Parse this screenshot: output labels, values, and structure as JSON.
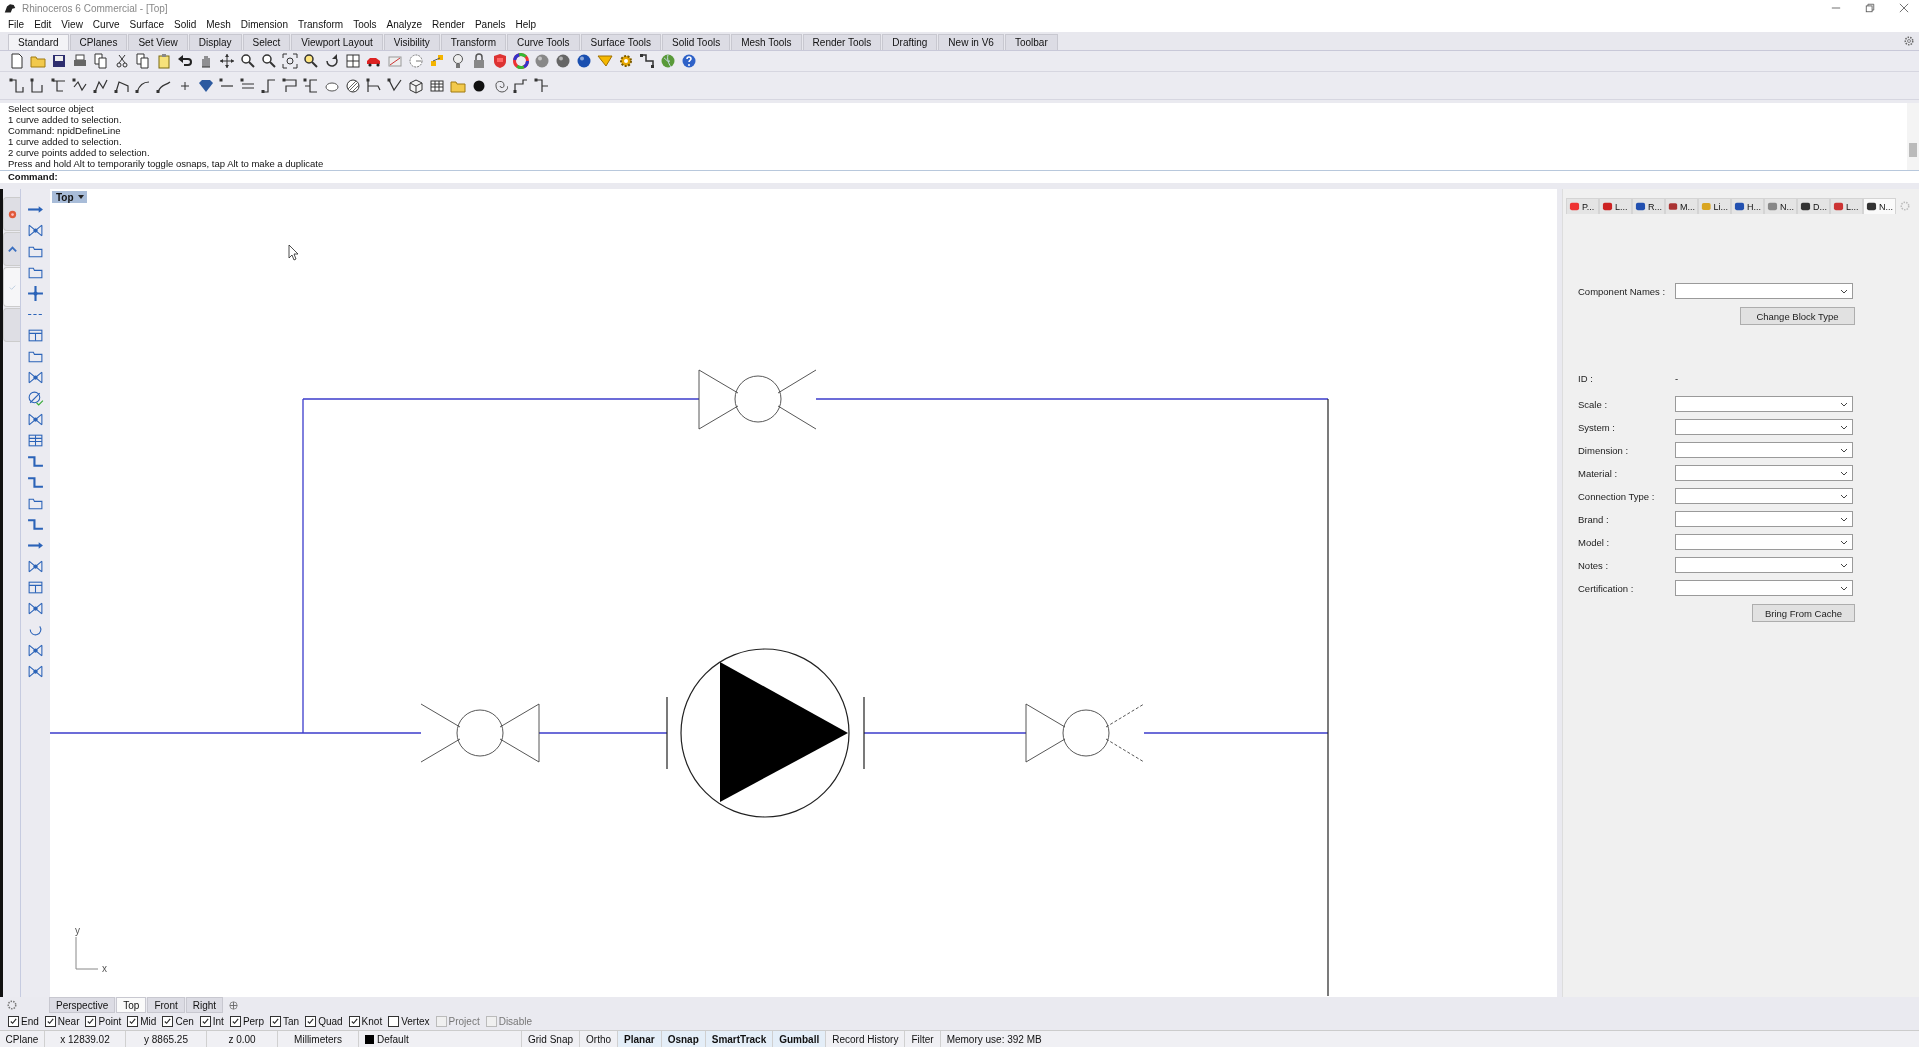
{
  "window": {
    "title": "Rhinoceros 6 Commercial - [Top]"
  },
  "menu": [
    "File",
    "Edit",
    "View",
    "Curve",
    "Surface",
    "Solid",
    "Mesh",
    "Dimension",
    "Transform",
    "Tools",
    "Analyze",
    "Render",
    "Panels",
    "Help"
  ],
  "toolbar_tabs": [
    {
      "label": "Standard",
      "selected": true
    },
    {
      "label": "CPlanes",
      "selected": false
    },
    {
      "label": "Set View",
      "selected": false
    },
    {
      "label": "Display",
      "selected": false
    },
    {
      "label": "Select",
      "selected": false
    },
    {
      "label": "Viewport Layout",
      "selected": false
    },
    {
      "label": "Visibility",
      "selected": false
    },
    {
      "label": "Transform",
      "selected": false
    },
    {
      "label": "Curve Tools",
      "selected": false
    },
    {
      "label": "Surface Tools",
      "selected": false
    },
    {
      "label": "Solid Tools",
      "selected": false
    },
    {
      "label": "Mesh Tools",
      "selected": false
    },
    {
      "label": "Render Tools",
      "selected": false
    },
    {
      "label": "Drafting",
      "selected": false
    },
    {
      "label": "New in V6",
      "selected": false
    },
    {
      "label": "Toolbar",
      "selected": false
    }
  ],
  "command_history": [
    "Select source object",
    "1 curve added to selection.",
    "Command: npidDefineLine",
    "1 curve added to selection.",
    "2 curve points added to selection.",
    "Press and hold Alt to temporarily toggle osnaps, tap Alt to make a duplicate"
  ],
  "command_prompt": "Command:",
  "side_tabs": [
    {
      "selected": false
    },
    {
      "selected": false
    },
    {
      "selected": true
    },
    {
      "selected": false
    }
  ],
  "viewport": {
    "label": "Top",
    "axes": {
      "x": "x",
      "y": "y"
    }
  },
  "panel_tabs": [
    {
      "label": "P...",
      "selected": false
    },
    {
      "label": "L...",
      "selected": false
    },
    {
      "label": "R...",
      "selected": false
    },
    {
      "label": "M...",
      "selected": false
    },
    {
      "label": "Li...",
      "selected": false
    },
    {
      "label": "H...",
      "selected": false
    },
    {
      "label": "N...",
      "selected": false
    },
    {
      "label": "D...",
      "selected": false
    },
    {
      "label": "L...",
      "selected": false
    },
    {
      "label": "N...",
      "selected": true
    }
  ],
  "panel": {
    "component_names": "Component Names :",
    "change_button": "Change Block Type",
    "id_label": "ID :",
    "id_value": "-",
    "fields": [
      {
        "label": "Scale :"
      },
      {
        "label": "System :"
      },
      {
        "label": "Dimension :"
      },
      {
        "label": "Material :"
      },
      {
        "label": "Connection Type :"
      },
      {
        "label": "Brand :"
      },
      {
        "label": "Model :"
      },
      {
        "label": "Notes :"
      },
      {
        "label": "Certification :"
      }
    ],
    "cache_button": "Bring From Cache"
  },
  "viewport_tabs": [
    {
      "label": "Perspective",
      "selected": false
    },
    {
      "label": "Top",
      "selected": true
    },
    {
      "label": "Front",
      "selected": false
    },
    {
      "label": "Right",
      "selected": false
    }
  ],
  "osnaps": [
    {
      "label": "End",
      "checked": true,
      "disabled": false
    },
    {
      "label": "Near",
      "checked": true,
      "disabled": false
    },
    {
      "label": "Point",
      "checked": true,
      "disabled": false
    },
    {
      "label": "Mid",
      "checked": true,
      "disabled": false
    },
    {
      "label": "Cen",
      "checked": true,
      "disabled": false
    },
    {
      "label": "Int",
      "checked": true,
      "disabled": false
    },
    {
      "label": "Perp",
      "checked": true,
      "disabled": false
    },
    {
      "label": "Tan",
      "checked": true,
      "disabled": false
    },
    {
      "label": "Quad",
      "checked": true,
      "disabled": false
    },
    {
      "label": "Knot",
      "checked": true,
      "disabled": false
    },
    {
      "label": "Vertex",
      "checked": false,
      "disabled": false
    },
    {
      "label": "Project",
      "checked": false,
      "disabled": true
    },
    {
      "label": "Disable",
      "checked": false,
      "disabled": true
    }
  ],
  "status_bar": {
    "cplane": "CPlane",
    "x": "x 12839.02",
    "y": "y 8865.25",
    "z": "z 0.00",
    "units": "Millimeters",
    "layer": "Default",
    "toggles": [
      {
        "label": "Grid Snap",
        "on": false
      },
      {
        "label": "Ortho",
        "on": false
      },
      {
        "label": "Planar",
        "on": true
      },
      {
        "label": "Osnap",
        "on": true
      },
      {
        "label": "SmartTrack",
        "on": true
      },
      {
        "label": "Gumball",
        "on": true
      },
      {
        "label": "Record History",
        "on": false
      },
      {
        "label": "Filter",
        "on": false
      }
    ],
    "memory": "Memory use: 392 MB"
  }
}
